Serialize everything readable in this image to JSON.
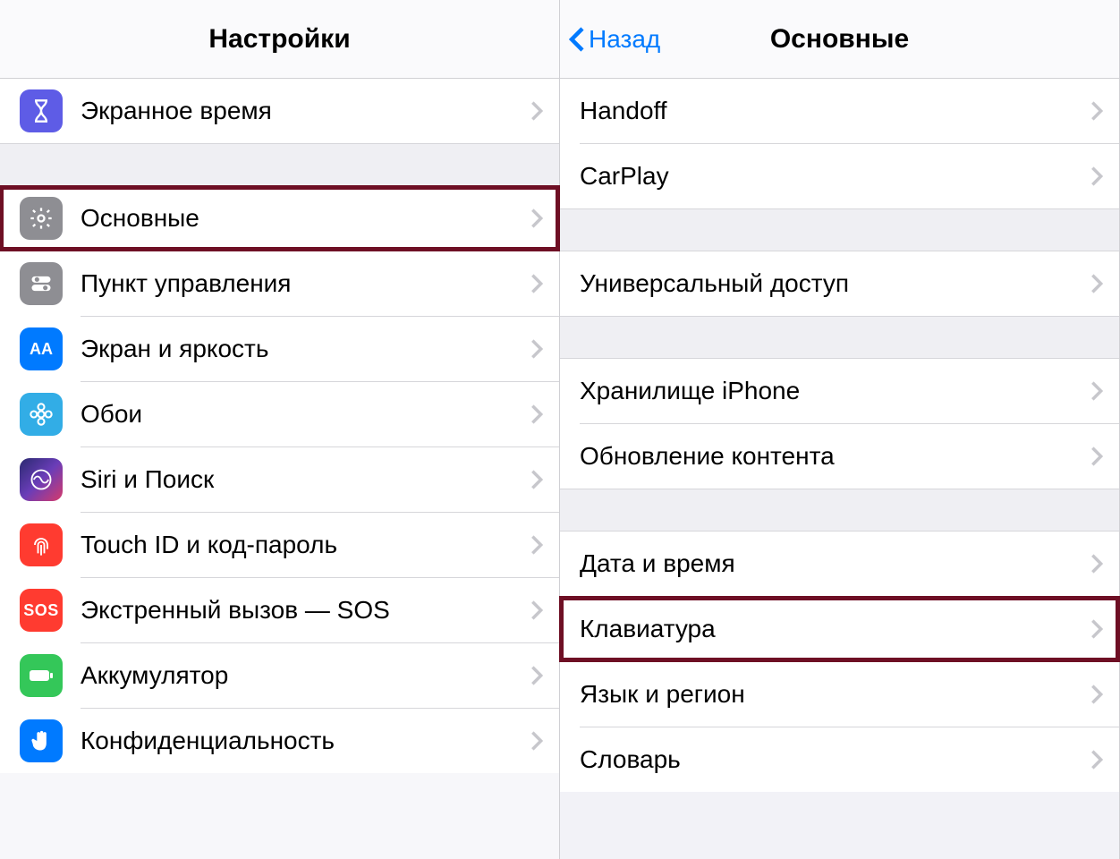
{
  "left": {
    "title": "Настройки",
    "groups": [
      {
        "items": [
          {
            "key": "screentime",
            "label": "Экранное время",
            "icon": "hourglass-icon",
            "iconClass": "ic-screentime"
          }
        ]
      },
      {
        "items": [
          {
            "key": "general",
            "label": "Основные",
            "icon": "gear-icon",
            "iconClass": "ic-general",
            "highlight": true
          },
          {
            "key": "control",
            "label": "Пункт управления",
            "icon": "toggles-icon",
            "iconClass": "ic-control"
          },
          {
            "key": "display",
            "label": "Экран и яркость",
            "icon": "aa-icon",
            "iconClass": "ic-display"
          },
          {
            "key": "wallpaper",
            "label": "Обои",
            "icon": "flower-icon",
            "iconClass": "ic-wallpaper"
          },
          {
            "key": "siri",
            "label": "Siri и Поиск",
            "icon": "siri-icon",
            "iconClass": "ic-siri"
          },
          {
            "key": "touchid",
            "label": "Touch ID и код-пароль",
            "icon": "fingerprint-icon",
            "iconClass": "ic-touchid"
          },
          {
            "key": "sos",
            "label": "Экстренный вызов — SOS",
            "icon": "sos-icon",
            "iconClass": "ic-sos"
          },
          {
            "key": "battery",
            "label": "Аккумулятор",
            "icon": "battery-icon",
            "iconClass": "ic-battery"
          },
          {
            "key": "privacy",
            "label": "Конфиденциальность",
            "icon": "hand-icon",
            "iconClass": "ic-privacy"
          }
        ]
      }
    ]
  },
  "right": {
    "back": "Назад",
    "title": "Основные",
    "groups": [
      {
        "items": [
          {
            "key": "handoff",
            "label": "Handoff"
          },
          {
            "key": "carplay",
            "label": "CarPlay"
          }
        ]
      },
      {
        "items": [
          {
            "key": "accessibility",
            "label": "Универсальный доступ"
          }
        ]
      },
      {
        "items": [
          {
            "key": "storage",
            "label": "Хранилище iPhone"
          },
          {
            "key": "refresh",
            "label": "Обновление контента"
          }
        ]
      },
      {
        "items": [
          {
            "key": "datetime",
            "label": "Дата и время"
          },
          {
            "key": "keyboard",
            "label": "Клавиатура",
            "highlight": true
          },
          {
            "key": "language",
            "label": "Язык и регион"
          },
          {
            "key": "dictionary",
            "label": "Словарь"
          }
        ]
      }
    ]
  }
}
